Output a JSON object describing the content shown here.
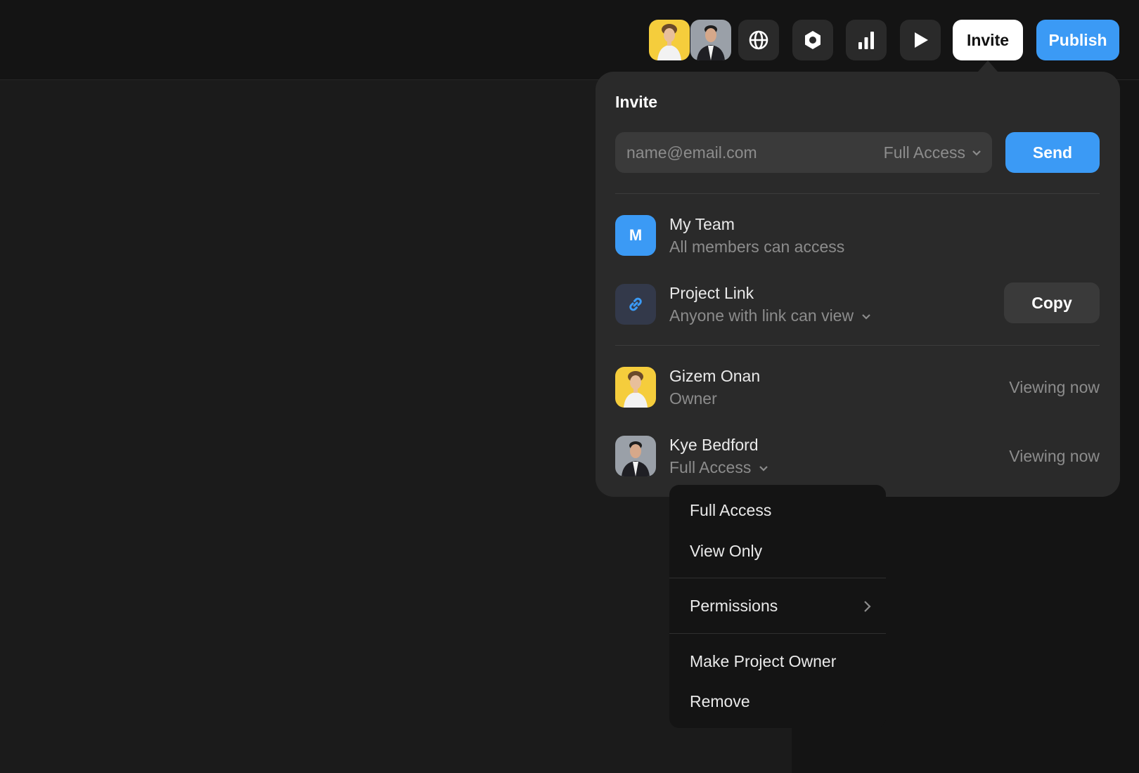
{
  "colors": {
    "accent": "#3b9af5",
    "panel": "#2a2a2a",
    "menu": "#141414",
    "muted_text": "#8c8c8c"
  },
  "toolbar": {
    "avatars": [
      {
        "name": "Gizem Onan",
        "bg": "#f5cd3c"
      },
      {
        "name": "Kye Bedford",
        "bg": "#9aa0a8"
      }
    ],
    "icons": [
      "globe-icon",
      "hexagon-settings-icon",
      "bar-chart-icon",
      "play-icon"
    ],
    "invite_label": "Invite",
    "publish_label": "Publish"
  },
  "invite_panel": {
    "title": "Invite",
    "email_placeholder": "name@email.com",
    "access_level": "Full Access",
    "send_label": "Send",
    "team": {
      "initial": "M",
      "name": "My Team",
      "description": "All members can access"
    },
    "project_link": {
      "name": "Project Link",
      "permission": "Anyone with link can view",
      "copy_label": "Copy"
    },
    "members": [
      {
        "name": "Gizem Onan",
        "role": "Owner",
        "status": "Viewing now"
      },
      {
        "name": "Kye Bedford",
        "role": "Full Access",
        "status": "Viewing now"
      }
    ]
  },
  "access_menu": {
    "items": [
      "Full Access",
      "View Only"
    ],
    "permissions_label": "Permissions",
    "owner_label": "Make Project Owner",
    "remove_label": "Remove"
  }
}
